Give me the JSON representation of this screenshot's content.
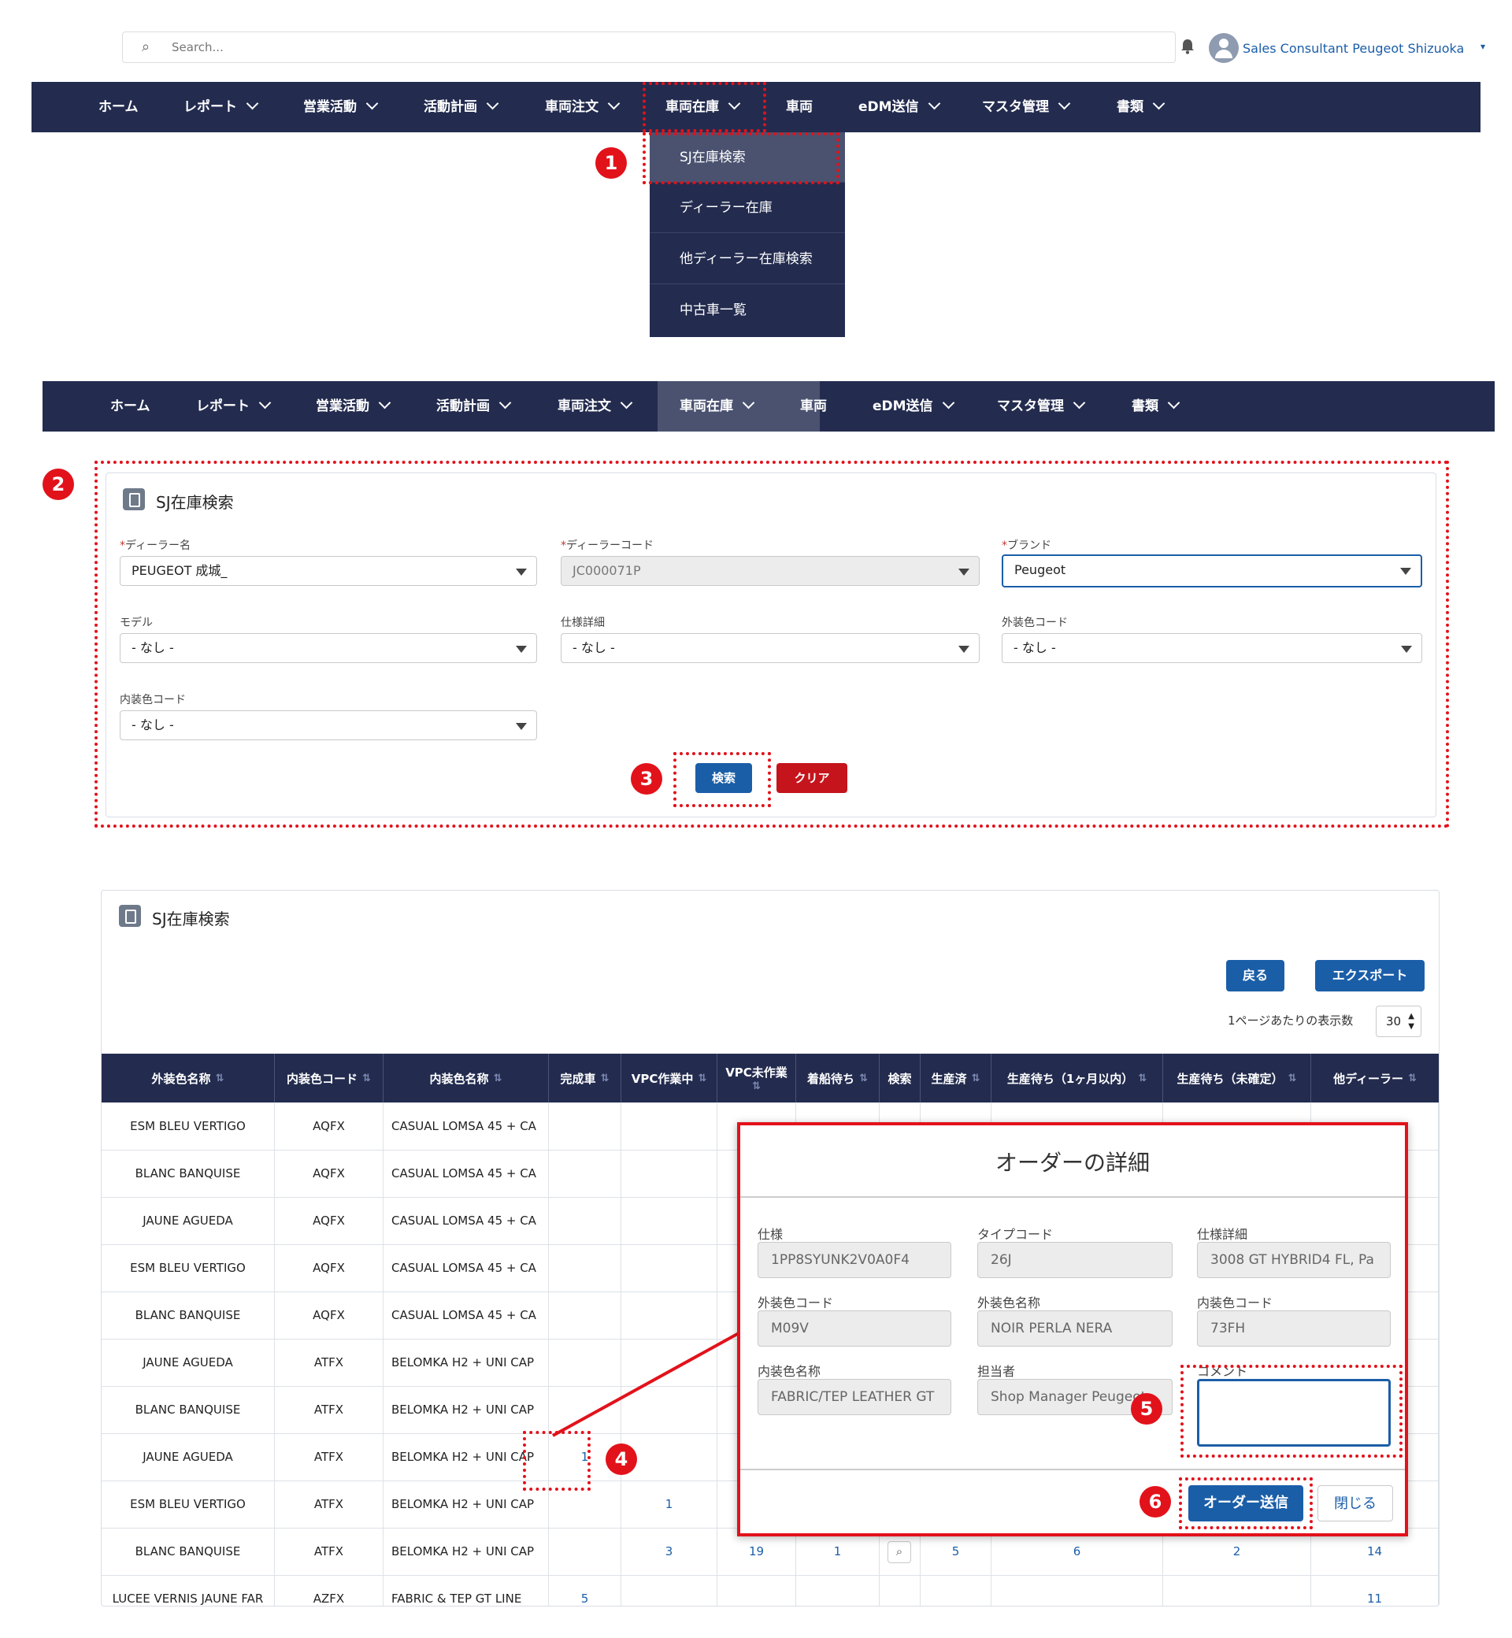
{
  "header": {
    "search_placeholder": "Search...",
    "user_name": "Sales Consultant Peugeot Shizuoka"
  },
  "nav": {
    "items": [
      {
        "label": "ホーム",
        "chevron": false
      },
      {
        "label": "レポート",
        "chevron": true
      },
      {
        "label": "営業活動",
        "chevron": true
      },
      {
        "label": "活動計画",
        "chevron": true
      },
      {
        "label": "車両注文",
        "chevron": true
      },
      {
        "label": "車両在庫",
        "chevron": true
      },
      {
        "label": "車両",
        "chevron": false
      },
      {
        "label": "eDM送信",
        "chevron": true
      },
      {
        "label": "マスタ管理",
        "chevron": true
      },
      {
        "label": "書類",
        "chevron": true
      }
    ],
    "dropdown": [
      "SJ在庫検索",
      "ディーラー在庫",
      "他ディーラー在庫検索",
      "中古車一覧"
    ]
  },
  "steps": [
    "1",
    "2",
    "3",
    "4",
    "5",
    "6"
  ],
  "search_form": {
    "title": "SJ在庫検索",
    "fields": {
      "dealer_name": {
        "label": "ディーラー名",
        "value": "PEUGEOT 成城_",
        "required": true
      },
      "dealer_code": {
        "label": "ディーラーコード",
        "value": "JC000071P",
        "required": true
      },
      "brand": {
        "label": "ブランド",
        "value": "Peugeot",
        "required": true
      },
      "model": {
        "label": "モデル",
        "value": "- なし -"
      },
      "spec_detail": {
        "label": "仕様詳細",
        "value": "- なし -"
      },
      "exterior_code": {
        "label": "外装色コード",
        "value": "- なし -"
      },
      "interior_code": {
        "label": "内装色コード",
        "value": "- なし -"
      }
    },
    "search_button": "検索",
    "clear_button": "クリア"
  },
  "results": {
    "title": "SJ在庫検索",
    "back_button": "戻る",
    "export_button": "エクスポート",
    "per_page_label": "1ページあたりの表示数",
    "per_page_value": "30",
    "columns": [
      "外装色名称",
      "内装色コード",
      "内装色名称",
      "完成車",
      "VPC作業中",
      "VPC未作業",
      "着船待ち",
      "検索",
      "生産済",
      "生産待ち（1ヶ月以内）",
      "生産待ち（未確定）",
      "他ディーラー"
    ],
    "rows": [
      [
        "ESM BLEU VERTIGO",
        "AQFX",
        "CASUAL LOMSA 45 + CA"
      ],
      [
        "BLANC BANQUISE",
        "AQFX",
        "CASUAL LOMSA 45 + CA"
      ],
      [
        "JAUNE AGUEDA",
        "AQFX",
        "CASUAL LOMSA 45 + CA"
      ],
      [
        "ESM BLEU VERTIGO",
        "AQFX",
        "CASUAL LOMSA 45 + CA"
      ],
      [
        "BLANC BANQUISE",
        "AQFX",
        "CASUAL LOMSA 45 + CA"
      ],
      [
        "JAUNE AGUEDA",
        "ATFX",
        "BELOMKA H2 + UNI CAP"
      ],
      [
        "BLANC BANQUISE",
        "ATFX",
        "BELOMKA H2 + UNI CAP"
      ],
      [
        "JAUNE AGUEDA",
        "ATFX",
        "BELOMKA H2 + UNI CAP"
      ],
      [
        "ESM BLEU VERTIGO",
        "ATFX",
        "BELOMKA H2 + UNI CAP"
      ],
      [
        "BLANC BANQUISE",
        "ATFX",
        "BELOMKA H2 + UNI CAP"
      ]
    ],
    "row8_complete": "1",
    "row9_vpc": "1",
    "row10": {
      "vpc": "3",
      "vpc_un": "19",
      "ship": "1",
      "done": "5",
      "wait1": "6",
      "wait_un": "2",
      "other": "14"
    },
    "partial_row": {
      "col1": "LUCEE VERNIS JAUNE FAR",
      "col2": "AZFX",
      "col3": "FABRIC & TEP GT LINE",
      "complete": "5",
      "other": "11"
    }
  },
  "modal": {
    "title": "オーダーの詳細",
    "fields": [
      {
        "label": "仕様",
        "value": "1PP8SYUNK2V0A0F4"
      },
      {
        "label": "タイプコード",
        "value": "26J"
      },
      {
        "label": "仕様詳細",
        "value": "3008 GT HYBRID4 FL, Pa"
      },
      {
        "label": "外装色コード",
        "value": "M09V"
      },
      {
        "label": "外装色名称",
        "value": "NOIR PERLA NERA"
      },
      {
        "label": "内装色コード",
        "value": "73FH"
      },
      {
        "label": "内装色名称",
        "value": "FABRIC/TEP LEATHER GT"
      },
      {
        "label": "担当者",
        "value": "Shop Manager Peugeot"
      }
    ],
    "comment_label": "コメント",
    "submit_button": "オーダー送信",
    "close_button": "閉じる"
  },
  "colors": {
    "nav": "#232c4f",
    "accent_red": "#e2121b",
    "brand_blue": "#1b5ea8",
    "clear_red": "#c5141c"
  }
}
